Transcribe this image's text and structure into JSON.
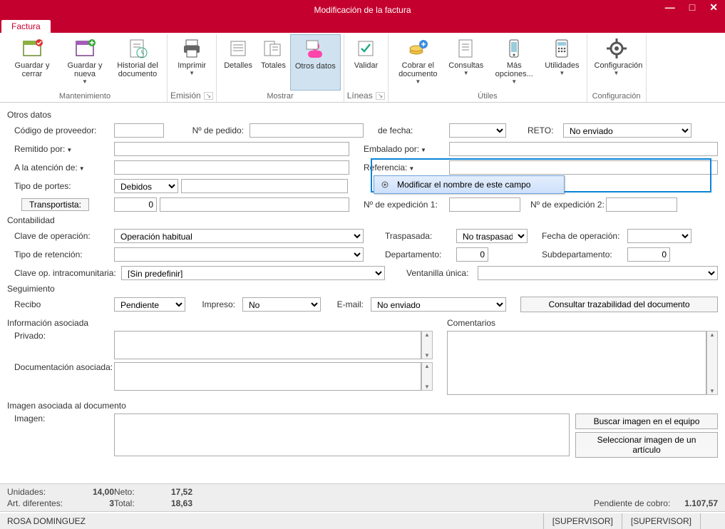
{
  "window": {
    "title": "Modificación de la factura"
  },
  "ribbon": {
    "tab": "Factura",
    "groups": {
      "mantenimiento": {
        "label": "Mantenimiento",
        "items": {
          "guardar_cerrar": "Guardar y cerrar",
          "guardar_nueva": "Guardar y nueva",
          "historial": "Historial del documento"
        }
      },
      "emision": {
        "label": "Emisión",
        "items": {
          "imprimir": "Imprimir"
        }
      },
      "mostrar": {
        "label": "Mostrar",
        "items": {
          "detalles": "Detalles",
          "totales": "Totales",
          "otros_datos": "Otros datos"
        }
      },
      "lineas": {
        "label": "Líneas",
        "items": {
          "validar": "Validar"
        }
      },
      "utiles": {
        "label": "Útiles",
        "items": {
          "cobrar": "Cobrar el documento",
          "consultas": "Consultas",
          "mas": "Más opciones...",
          "utilidades": "Utilidades"
        }
      },
      "configuracion": {
        "label": "Configuración",
        "items": {
          "configuracion": "Configuración"
        }
      }
    }
  },
  "form": {
    "otros_datos": {
      "title": "Otros datos",
      "codigo_proveedor_label": "Código de proveedor:",
      "num_pedido_label": "Nº de pedido:",
      "de_fecha_label": "de fecha:",
      "reto_label": "RETO:",
      "reto_value": "No enviado",
      "remitido_label": "Remitido por:",
      "embalado_label": "Embalado por:",
      "atencion_label": "A la atención de:",
      "referencia_label": "Referencia:",
      "portes_label": "Tipo de portes:",
      "portes_value": "Debidos",
      "transportista_label": "Transportista:",
      "transportista_value": "0",
      "exp1_label": "Nº de expedición 1:",
      "exp2_label": "Nº de expedición 2:"
    },
    "contabilidad": {
      "title": "Contabilidad",
      "clave_label": "Clave de operación:",
      "clave_value": "Operación habitual",
      "retencion_label": "Tipo de retención:",
      "intracom_label": "Clave op. intracomunitaria:",
      "intracom_value": "[Sin predefinir]",
      "traspasada_label": "Traspasada:",
      "traspasada_value": "No traspasada",
      "fecha_op_label": "Fecha de operación:",
      "departamento_label": "Departamento:",
      "departamento_value": "0",
      "subdep_label": "Subdepartamento:",
      "subdep_value": "0",
      "ventanilla_label": "Ventanilla única:"
    },
    "seguimiento": {
      "title": "Seguimiento",
      "recibo_label": "Recibo",
      "recibo_value": "Pendiente",
      "impreso_label": "Impreso:",
      "impreso_value": "No",
      "email_label": "E-mail:",
      "email_value": "No enviado",
      "trazabilidad_btn": "Consultar trazabilidad del documento"
    },
    "info_asociada": {
      "title": "Información asociada",
      "privado_label": "Privado:",
      "doc_label": "Documentación asociada:",
      "comentarios_label": "Comentarios"
    },
    "imagen": {
      "title": "Imagen asociada al documento",
      "imagen_label": "Imagen:",
      "buscar_btn": "Buscar imagen en el equipo",
      "seleccionar_btn": "Seleccionar imagen de un artículo"
    }
  },
  "context_menu": {
    "item1": "Modificar el nombre de este campo"
  },
  "totals": {
    "unidades_label": "Unidades:",
    "unidades_value": "14,00",
    "art_dif_label": "Art. diferentes:",
    "art_dif_value": "3",
    "neto_label": "Neto:",
    "neto_value": "17,52",
    "total_label": "Total:",
    "total_value": "18,63",
    "pendiente_label": "Pendiente de cobro:",
    "pendiente_value": "1.107,57"
  },
  "statusbar": {
    "user": "ROSA DOMINGUEZ",
    "role1": "[SUPERVISOR]",
    "role2": "[SUPERVISOR]"
  }
}
